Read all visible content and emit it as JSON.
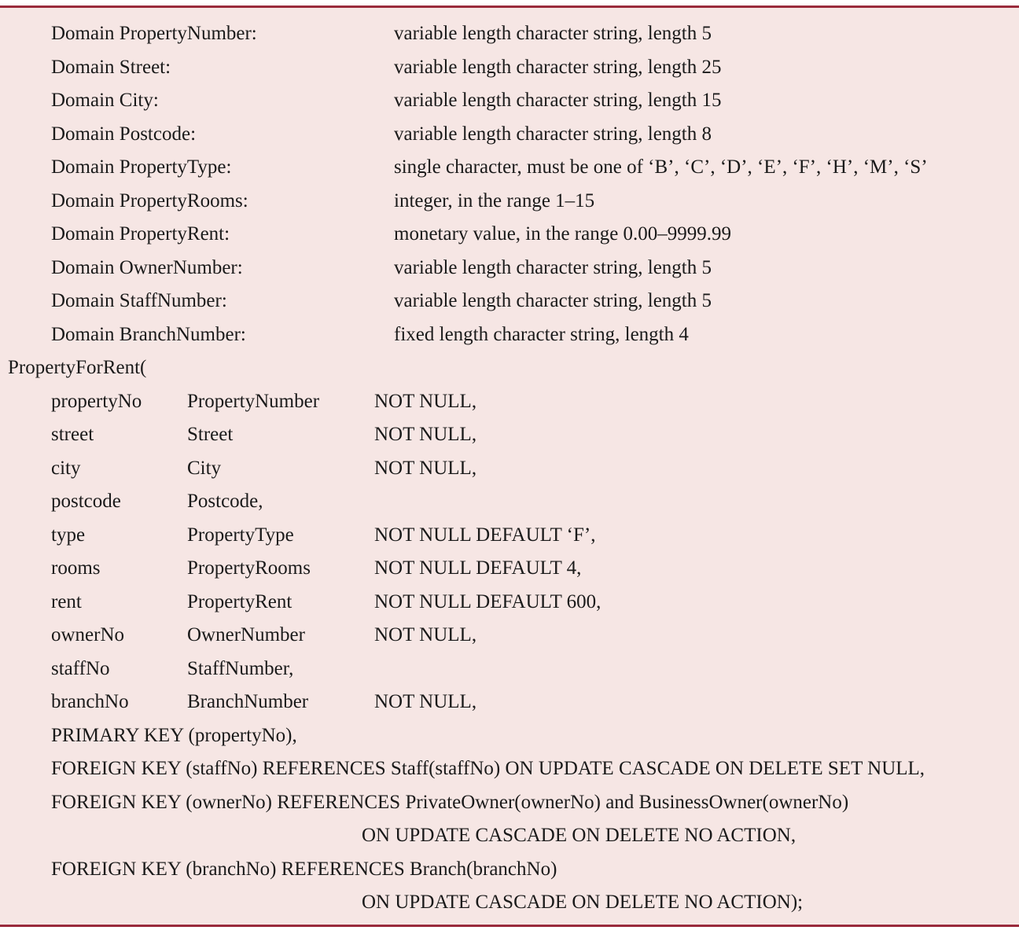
{
  "domains": [
    {
      "name": "Domain PropertyNumber:",
      "definition": "variable length character string, length 5"
    },
    {
      "name": "Domain Street:",
      "definition": "variable length character string, length 25"
    },
    {
      "name": "Domain City:",
      "definition": "variable length character string, length 15"
    },
    {
      "name": "Domain Postcode:",
      "definition": "variable length character string, length 8"
    },
    {
      "name": "Domain PropertyType:",
      "definition": "single character, must be one of ‘B’, ‘C’, ‘D’, ‘E’, ‘F’, ‘H’, ‘M’, ‘S’"
    },
    {
      "name": "Domain PropertyRooms:",
      "definition": "integer, in the range 1–15"
    },
    {
      "name": "Domain PropertyRent:",
      "definition": "monetary value, in the range 0.00–9999.99"
    },
    {
      "name": "Domain OwnerNumber:",
      "definition": "variable length character string, length 5"
    },
    {
      "name": "Domain StaffNumber:",
      "definition": "variable length character string, length 5"
    },
    {
      "name": "Domain BranchNumber:",
      "definition": "fixed length character string, length 4"
    }
  ],
  "table": {
    "header": "PropertyForRent(",
    "attributes": [
      {
        "attr": "propertyNo",
        "domain": "PropertyNumber",
        "constraint": "NOT NULL,"
      },
      {
        "attr": "street",
        "domain": "Street",
        "constraint": "NOT NULL,"
      },
      {
        "attr": "city",
        "domain": "City",
        "constraint": "NOT NULL,"
      },
      {
        "attr": "postcode",
        "domain": "Postcode,",
        "constraint": ""
      },
      {
        "attr": "type",
        "domain": "PropertyType",
        "constraint": "NOT NULL DEFAULT ‘F’,"
      },
      {
        "attr": "rooms",
        "domain": "PropertyRooms",
        "constraint": "NOT NULL DEFAULT 4,"
      },
      {
        "attr": "rent",
        "domain": "PropertyRent",
        "constraint": "NOT NULL DEFAULT 600,"
      },
      {
        "attr": "ownerNo",
        "domain": "OwnerNumber",
        "constraint": "NOT NULL,"
      },
      {
        "attr": "staffNo",
        "domain": "StaffNumber,",
        "constraint": ""
      },
      {
        "attr": "branchNo",
        "domain": "BranchNumber",
        "constraint": "NOT NULL,"
      }
    ],
    "primary_key": "PRIMARY KEY (propertyNo),",
    "fk_staff": "FOREIGN KEY (staffNo) REFERENCES Staff(staffNo) ON UPDATE CASCADE ON DELETE SET NULL,",
    "fk_owner": "FOREIGN KEY (ownerNo) REFERENCES PrivateOwner(ownerNo) and BusinessOwner(ownerNo)",
    "fk_owner_actions": "ON UPDATE CASCADE ON DELETE NO ACTION,",
    "fk_branch": "FOREIGN KEY (branchNo) REFERENCES Branch(branchNo)",
    "fk_branch_actions": "ON UPDATE CASCADE ON DELETE NO ACTION);"
  },
  "colors": {
    "background": "#f6e6e4",
    "rule": "#9a2b3c",
    "text": "#1a1a1a"
  }
}
